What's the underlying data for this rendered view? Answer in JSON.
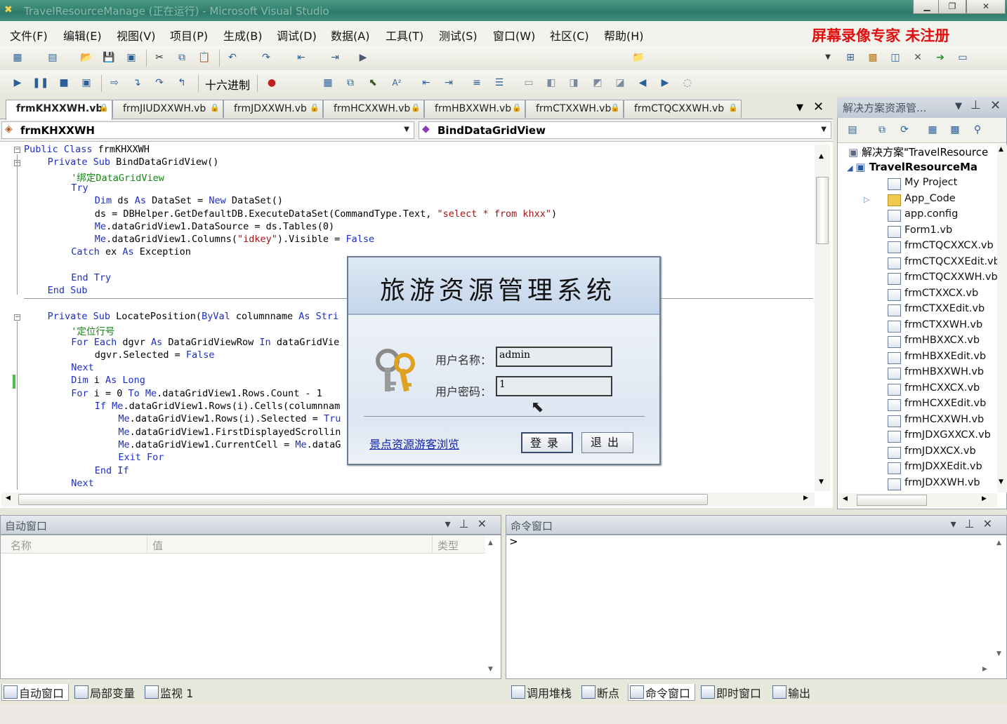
{
  "window": {
    "title": "TravelResourceManage (正在运行) - Microsoft Visual Studio"
  },
  "menu": [
    "文件(F)",
    "编辑(E)",
    "视图(V)",
    "项目(P)",
    "生成(B)",
    "调试(D)",
    "数据(A)",
    "工具(T)",
    "测试(S)",
    "窗口(W)",
    "社区(C)",
    "帮助(H)"
  ],
  "watermark": "屏幕录像专家  未注册",
  "toolbar2": {
    "hex_label": "十六进制"
  },
  "tabs": [
    "frmKHXXWH.vb",
    "frmJIUDXXWH.vb",
    "frmJDXXWH.vb",
    "frmHCXXWH.vb",
    "frmHBXXWH.vb",
    "frmCTXXWH.vb",
    "frmCTQCXXWH.vb"
  ],
  "nav": {
    "class_combo": "frmKHXXWH",
    "method_combo": "BindDataGridView"
  },
  "code": [
    {
      "i": 0,
      "parts": [
        [
          "kw",
          "Public Class "
        ],
        [
          "",
          "frmKHXXWH"
        ]
      ]
    },
    {
      "i": 1,
      "parts": [
        [
          "kw",
          "Private Sub "
        ],
        [
          "",
          "BindDataGridView()"
        ]
      ]
    },
    {
      "i": 2,
      "parts": [
        [
          "cm",
          "'绑定DataGridView"
        ]
      ]
    },
    {
      "i": 2,
      "parts": [
        [
          "kw",
          "Try"
        ]
      ]
    },
    {
      "i": 3,
      "parts": [
        [
          "kw",
          "Dim "
        ],
        [
          "",
          "ds "
        ],
        [
          "kw",
          "As "
        ],
        [
          "",
          "DataSet = "
        ],
        [
          "kw",
          "New "
        ],
        [
          "",
          "DataSet()"
        ]
      ]
    },
    {
      "i": 3,
      "parts": [
        [
          "",
          "ds = DBHelper.GetDefaultDB.ExecuteDataSet(CommandType.Text, "
        ],
        [
          "st",
          "\"select * from khxx\""
        ],
        [
          "",
          ")"
        ]
      ]
    },
    {
      "i": 3,
      "parts": [
        [
          "kw",
          "Me"
        ],
        [
          "",
          ".dataGridView1.DataSource = ds.Tables(0)"
        ]
      ]
    },
    {
      "i": 3,
      "parts": [
        [
          "kw",
          "Me"
        ],
        [
          "",
          ".dataGridView1.Columns("
        ],
        [
          "st",
          "\"idkey\""
        ],
        [
          "",
          ").Visible = "
        ],
        [
          "kw",
          "False"
        ]
      ]
    },
    {
      "i": 2,
      "parts": [
        [
          "kw",
          "Catch "
        ],
        [
          "",
          "ex "
        ],
        [
          "kw",
          "As "
        ],
        [
          "",
          "Exception"
        ]
      ]
    },
    {
      "i": 0,
      "parts": [
        [
          "",
          ""
        ]
      ]
    },
    {
      "i": 2,
      "parts": [
        [
          "kw",
          "End Try"
        ]
      ]
    },
    {
      "i": 1,
      "parts": [
        [
          "kw",
          "End Sub"
        ]
      ]
    },
    {
      "i": 0,
      "parts": [
        [
          "",
          ""
        ]
      ]
    },
    {
      "i": 1,
      "parts": [
        [
          "kw",
          "Private Sub "
        ],
        [
          "",
          "LocatePosition("
        ],
        [
          "kw",
          "ByVal "
        ],
        [
          "",
          "columnname "
        ],
        [
          "kw",
          "As "
        ],
        [
          "kw",
          "Stri"
        ]
      ]
    },
    {
      "i": 2,
      "parts": [
        [
          "cm",
          "'定位行号"
        ]
      ]
    },
    {
      "i": 2,
      "parts": [
        [
          "kw",
          "For Each "
        ],
        [
          "",
          "dgvr "
        ],
        [
          "kw",
          "As "
        ],
        [
          "",
          "DataGridViewRow "
        ],
        [
          "kw",
          "In "
        ],
        [
          "",
          "dataGridVie"
        ]
      ]
    },
    {
      "i": 3,
      "parts": [
        [
          "",
          "dgvr.Selected = "
        ],
        [
          "kw",
          "False"
        ]
      ]
    },
    {
      "i": 2,
      "parts": [
        [
          "kw",
          "Next"
        ]
      ]
    },
    {
      "i": 2,
      "parts": [
        [
          "kw",
          "Dim "
        ],
        [
          "",
          "i "
        ],
        [
          "kw",
          "As Long"
        ]
      ]
    },
    {
      "i": 2,
      "parts": [
        [
          "kw",
          "For "
        ],
        [
          "",
          "i = 0 "
        ],
        [
          "kw",
          "To Me"
        ],
        [
          "",
          ".dataGridView1.Rows.Count - 1"
        ]
      ]
    },
    {
      "i": 3,
      "parts": [
        [
          "kw",
          "If Me"
        ],
        [
          "",
          ".dataGridView1.Rows(i).Cells(columnnam"
        ]
      ]
    },
    {
      "i": 4,
      "parts": [
        [
          "kw",
          "Me"
        ],
        [
          "",
          ".dataGridView1.Rows(i).Selected = "
        ],
        [
          "kw",
          "Tru"
        ]
      ]
    },
    {
      "i": 4,
      "parts": [
        [
          "kw",
          "Me"
        ],
        [
          "",
          ".dataGridView1.FirstDisplayedScrollin"
        ]
      ]
    },
    {
      "i": 4,
      "parts": [
        [
          "kw",
          "Me"
        ],
        [
          "",
          ".dataGridView1.CurrentCell = "
        ],
        [
          "kw",
          "Me"
        ],
        [
          "",
          ".dataG"
        ]
      ]
    },
    {
      "i": 4,
      "parts": [
        [
          "kw",
          "Exit For"
        ]
      ]
    },
    {
      "i": 3,
      "parts": [
        [
          "kw",
          "End If"
        ]
      ]
    },
    {
      "i": 2,
      "parts": [
        [
          "kw",
          "Next"
        ]
      ]
    }
  ],
  "solution": {
    "title": "解决方案资源管...",
    "root": "解决方案\"TravelResource",
    "project": "TravelResourceMa",
    "items": [
      "My Project",
      "App_Code",
      "app.config",
      "Form1.vb",
      "frmCTQCXXCX.vb",
      "frmCTQCXXEdit.vb",
      "frmCTQCXXWH.vb",
      "frmCTXXCX.vb",
      "frmCTXXEdit.vb",
      "frmCTXXWH.vb",
      "frmHBXXCX.vb",
      "frmHBXXEdit.vb",
      "frmHBXXWH.vb",
      "frmHCXXCX.vb",
      "frmHCXXEdit.vb",
      "frmHCXXWH.vb",
      "frmJDXGXXCX.vb",
      "frmJDXXCX.vb",
      "frmJDXXEdit.vb",
      "frmJDXXWH.vb"
    ]
  },
  "autos": {
    "title": "自动窗口",
    "col_name": "名称",
    "col_value": "值",
    "col_type": "类型"
  },
  "command": {
    "title": "命令窗口",
    "prompt": ">"
  },
  "bottom_tabs_left": [
    "自动窗口",
    "局部变量",
    "监视 1"
  ],
  "bottom_tabs_right": [
    "调用堆栈",
    "断点",
    "命令窗口",
    "即时窗口",
    "输出"
  ],
  "dialog": {
    "title": "旅游资源管理系统",
    "user_label": "用户名称：",
    "user_value": "admin",
    "pass_label": "用户密码：",
    "pass_value": "1",
    "link": "景点资源游客浏览",
    "login": "登录",
    "exit": "退出"
  },
  "colors": {
    "keyword": "#1c2ec8",
    "comment": "#118811",
    "string": "#a31515",
    "watermark": "#e01010"
  }
}
